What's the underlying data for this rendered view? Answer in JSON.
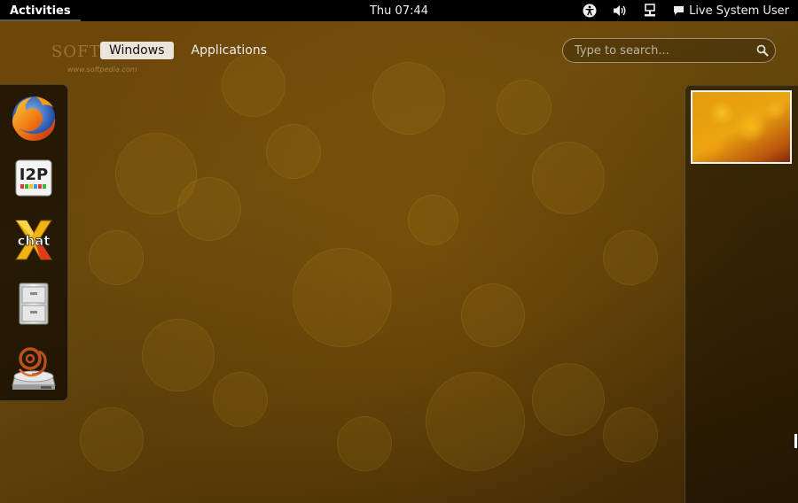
{
  "topbar": {
    "activities_label": "Activities",
    "clock": "Thu 07:44",
    "tray_icons": [
      "accessibility-icon",
      "volume-icon",
      "network-icon"
    ],
    "user_label": "Live System User",
    "user_icon": "chat-bubble-icon"
  },
  "watermark": {
    "brand": "SOFTP",
    "url": "www.softpedia.com"
  },
  "view_selector": {
    "tabs": [
      {
        "label": "Windows",
        "active": true
      },
      {
        "label": "Applications",
        "active": false
      }
    ]
  },
  "search": {
    "value": "",
    "placeholder": "Type to search..."
  },
  "dash": {
    "items": [
      {
        "name": "firefox",
        "icon": "firefox-icon"
      },
      {
        "name": "i2p",
        "icon": "i2p-icon",
        "text": "I2P"
      },
      {
        "name": "xchat",
        "icon": "xchat-icon",
        "text": "chat"
      },
      {
        "name": "file-cabinet",
        "icon": "file-cabinet-icon"
      },
      {
        "name": "disc-burner",
        "icon": "disc-burner-icon"
      }
    ]
  },
  "workspaces": {
    "count": 1,
    "active_index": 0
  },
  "colors": {
    "topbar": "#000000",
    "background": "#6a4a0c",
    "dash_bg": "rgba(0,0,0,0.65)",
    "thumb_accent": "#eaa512"
  }
}
